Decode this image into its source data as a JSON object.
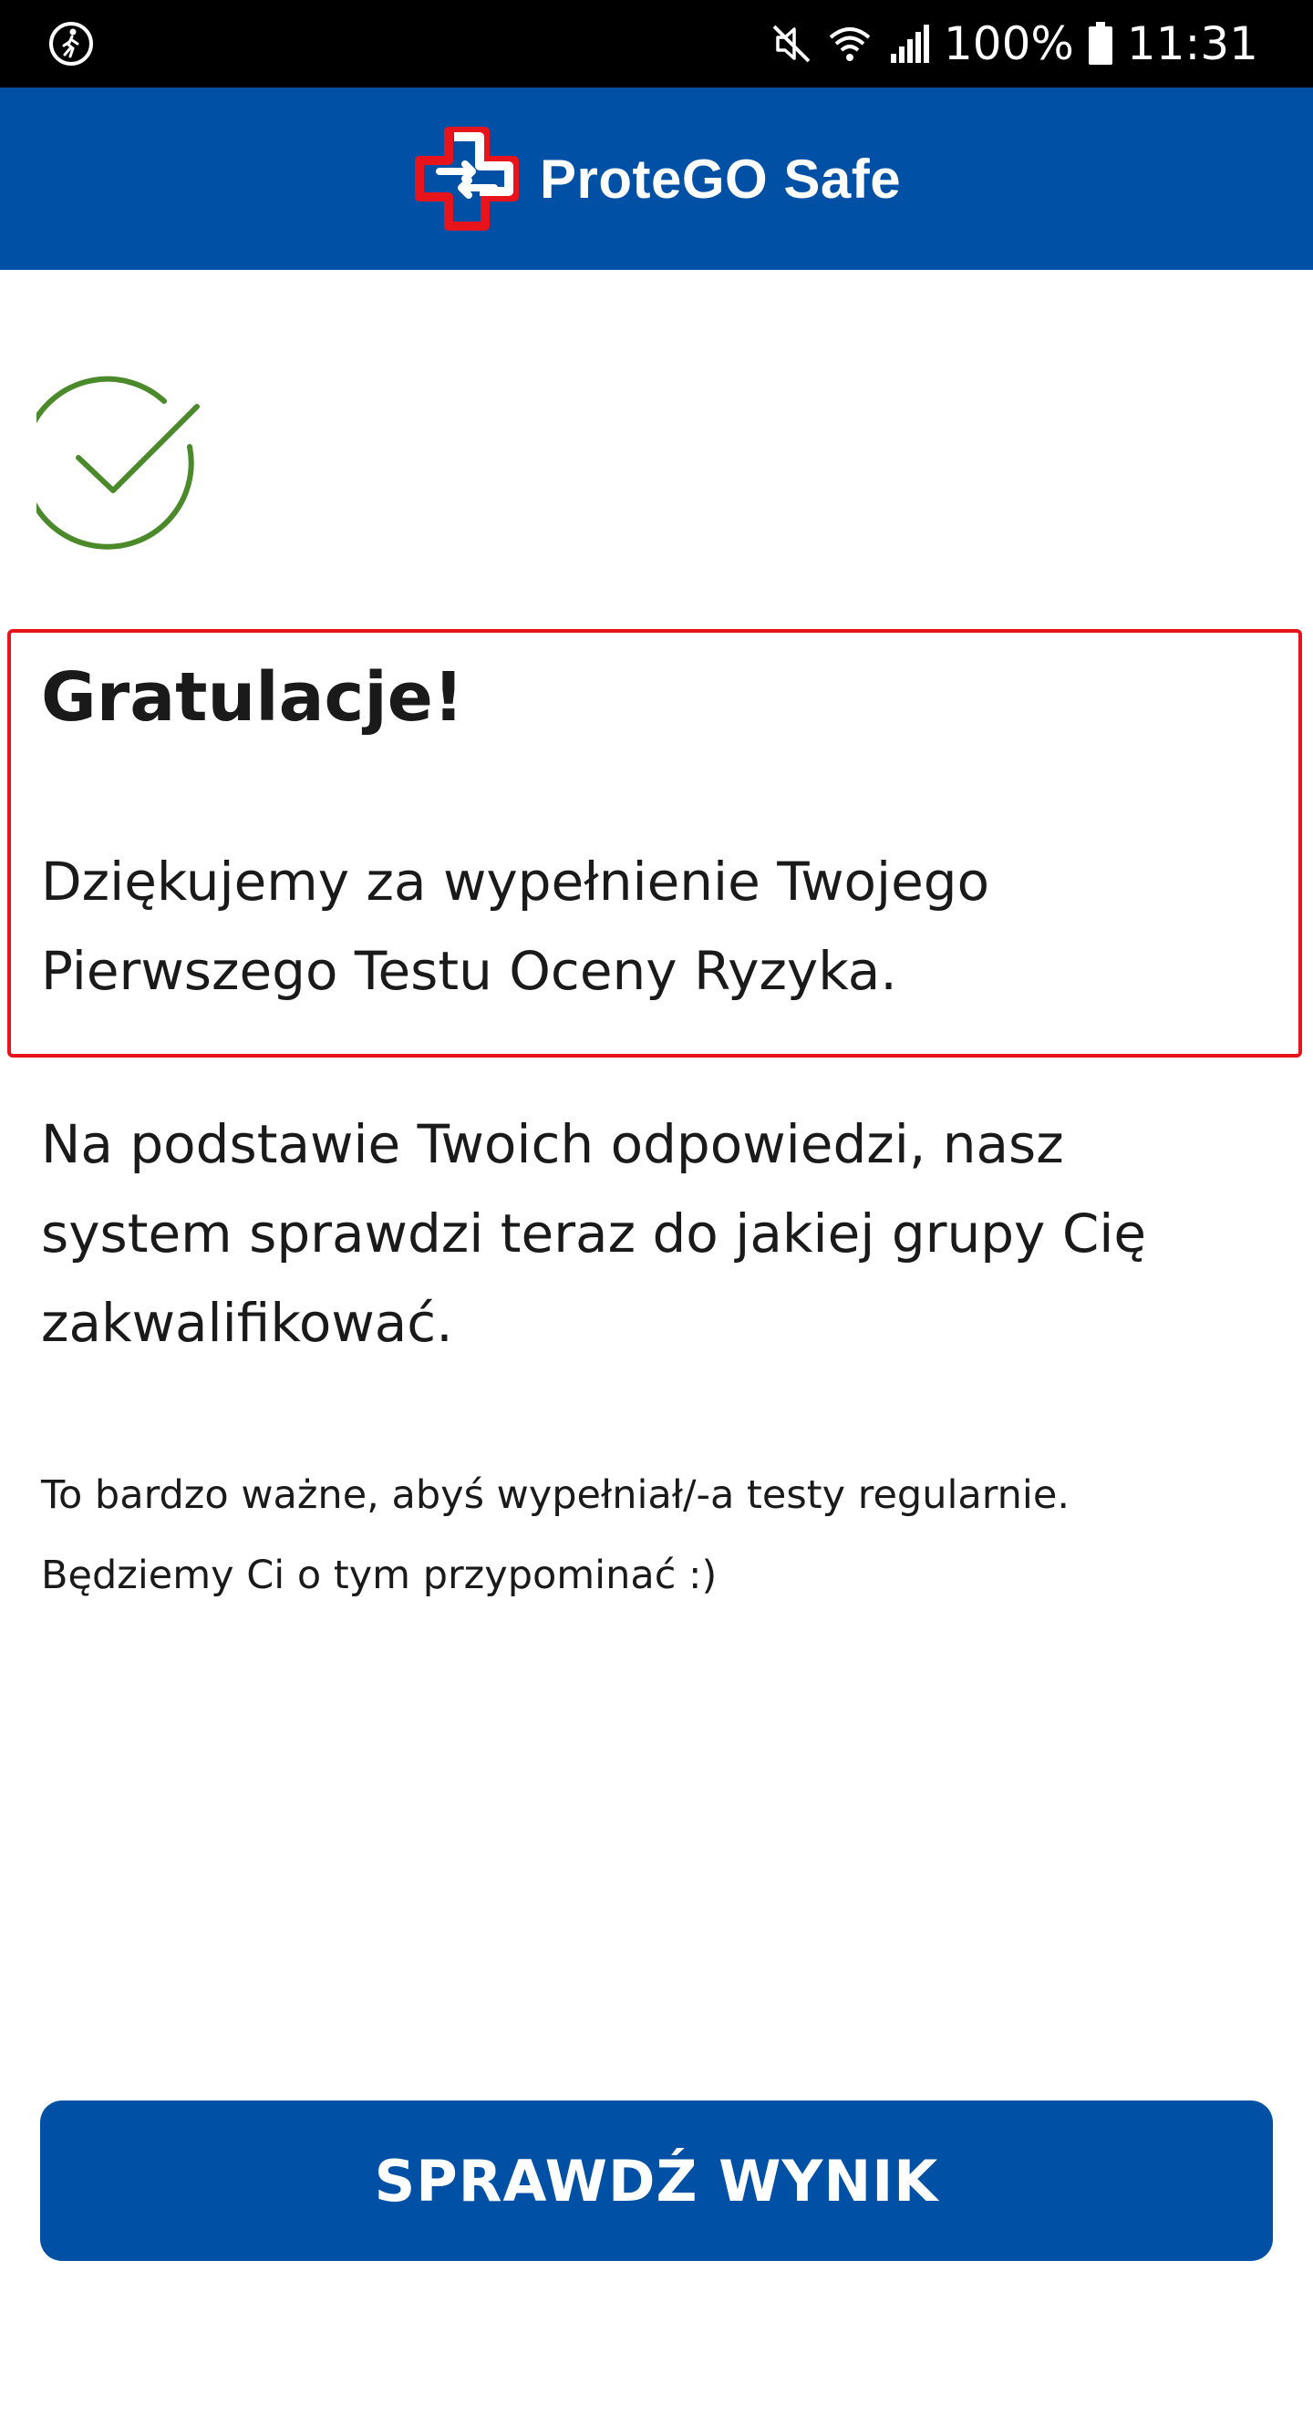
{
  "status_bar": {
    "battery": "100%",
    "time": "11:31",
    "left_icon": "step-counter-icon",
    "icons": [
      "mute-icon",
      "wifi-icon",
      "signal-icon",
      "battery-icon"
    ]
  },
  "app_bar": {
    "logo_icon": "protego-cross-logo",
    "title": "ProteGO Safe"
  },
  "content": {
    "status_icon": "check-circle-icon",
    "heading": "Gratulacje!",
    "thanks": "Dziękujemy za wypełnienie Twojego Pierwszego Testu Oceny Ryzyka.",
    "info": "Na podstawie Twoich odpowiedzi, nasz system sprawdzi teraz do jakiej grupy Cię zakwalifikować.",
    "note": "To bardzo ważne, abyś wypełniał/-a testy regularnie. Będziemy Ci o tym przypominać :)"
  },
  "actions": {
    "check_result_label": "SPRAWDŹ WYNIK"
  },
  "colors": {
    "brand_blue": "#0051a5",
    "accent_red": "#e8141c",
    "success_green": "#4a8a2a"
  }
}
